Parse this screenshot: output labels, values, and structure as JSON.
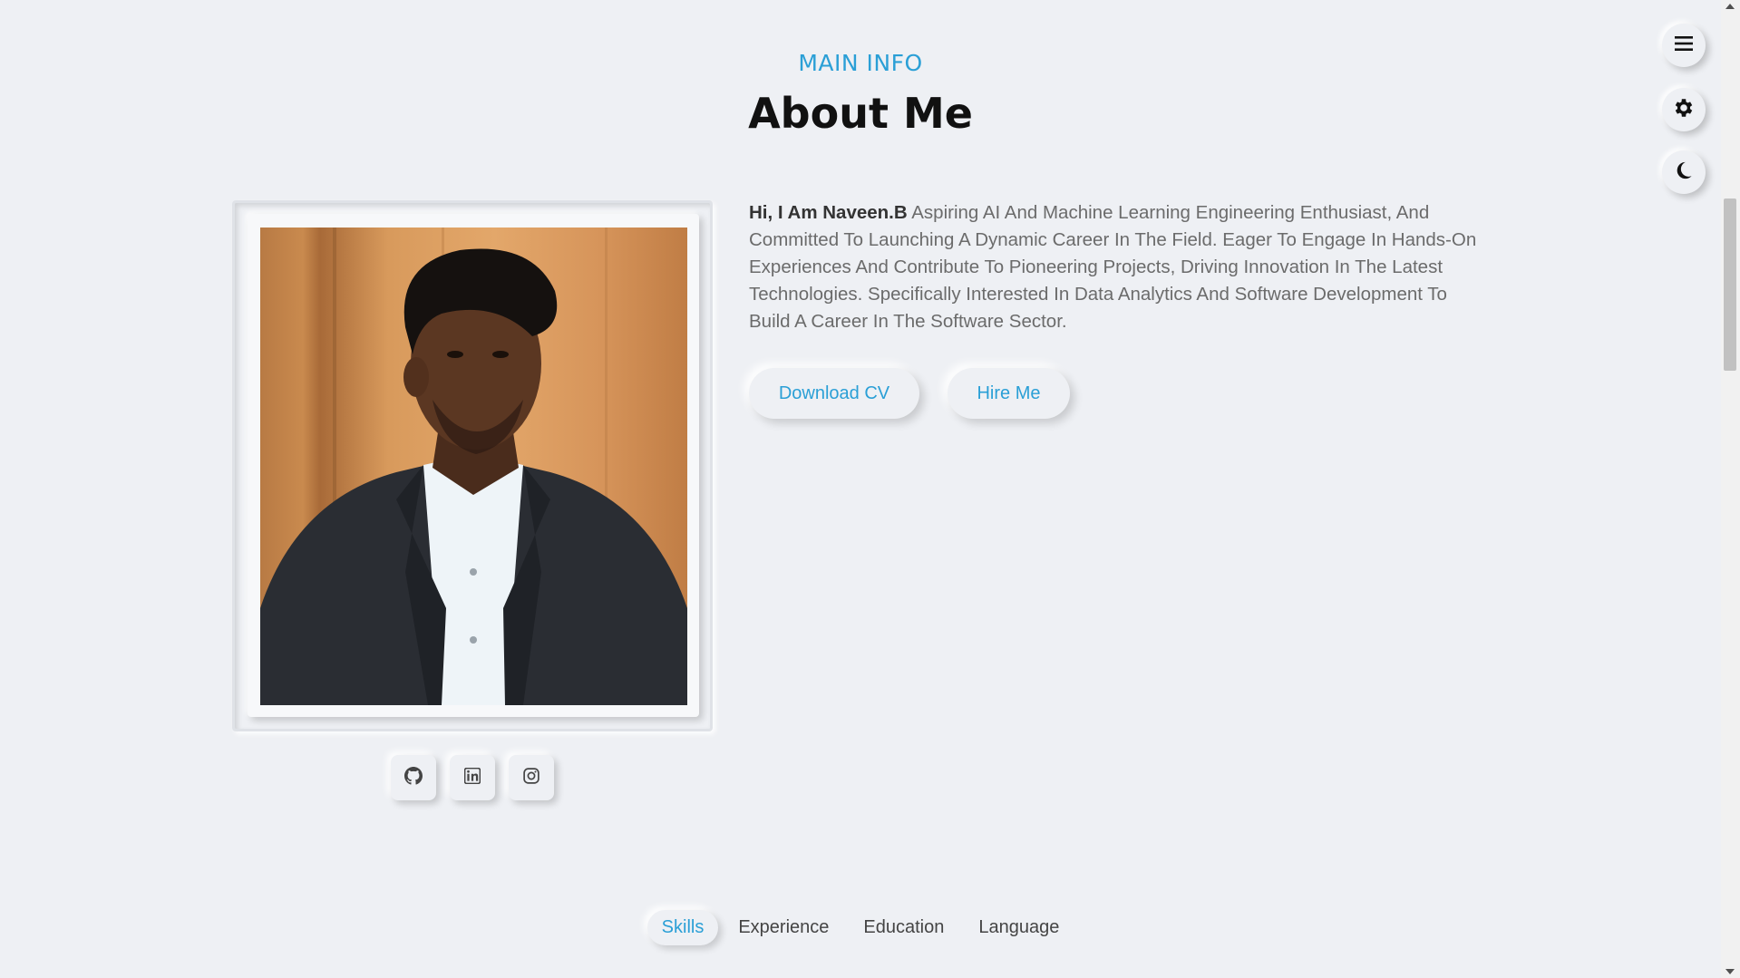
{
  "header": {
    "subtitle": "MAIN INFO",
    "title": "About Me"
  },
  "about": {
    "lead": "Hi, I Am Naveen.B",
    "body": " Aspiring AI And Machine Learning Engineering Enthusiast, And Committed To Launching A Dynamic Career In The Field. Eager To Engage In Hands-On Experiences And Contribute To Pioneering Projects, Driving Innovation In The Latest Technologies. Specifically Interested In Data Analytics And Software Development To Build A Career In The Software Sector."
  },
  "buttons": {
    "download_cv": "Download CV",
    "hire_me": "Hire Me"
  },
  "social": [
    "github-icon",
    "linkedin-icon",
    "instagram-icon"
  ],
  "floating_menu": [
    "menu-icon",
    "gear-icon",
    "moon-icon"
  ],
  "tabs": [
    {
      "label": "Skills",
      "active": true
    },
    {
      "label": "Experience",
      "active": false
    },
    {
      "label": "Education",
      "active": false
    },
    {
      "label": "Language",
      "active": false
    }
  ],
  "colors": {
    "accent": "#2a9fd6",
    "background": "#eef0f4"
  }
}
